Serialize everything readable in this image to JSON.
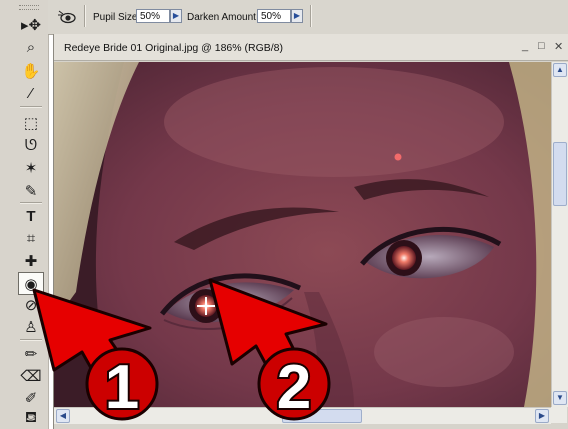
{
  "options_bar": {
    "pupil_size_label": "Pupil Size",
    "pupil_size_value": "50%",
    "darken_amount_label": "Darken Amount",
    "darken_amount_value": "50%"
  },
  "document": {
    "title": "Redeye Bride 01 Original.jpg @ 186% (RGB/8)",
    "minimize_glyph": "_",
    "maximize_glyph": "□",
    "close_glyph": "✕"
  },
  "toolbox": {
    "tools": [
      {
        "name": "move-tool",
        "glyph": "▸✥"
      },
      {
        "name": "zoom-tool",
        "glyph": "⌕"
      },
      {
        "name": "hand-tool",
        "glyph": "✋"
      },
      {
        "name": "eyedropper-tool",
        "glyph": "⁄"
      },
      {
        "name": "marquee-tool",
        "glyph": "⬚"
      },
      {
        "name": "lasso-tool",
        "glyph": "ᘎ"
      },
      {
        "name": "magic-wand-tool",
        "glyph": "✶"
      },
      {
        "name": "quick-selection-tool",
        "glyph": "✎"
      },
      {
        "name": "type-tool",
        "glyph": "T"
      },
      {
        "name": "crop-tool",
        "glyph": "⌗"
      },
      {
        "name": "spot-healing-tool",
        "glyph": "✚"
      },
      {
        "name": "red-eye-tool",
        "glyph": "◉"
      },
      {
        "name": "healing-brush-tool",
        "glyph": "⊘"
      },
      {
        "name": "clone-stamp-tool",
        "glyph": "♙"
      },
      {
        "name": "pencil-tool",
        "glyph": "✏"
      },
      {
        "name": "eraser-tool",
        "glyph": "⌫"
      },
      {
        "name": "brush-tool",
        "glyph": "✐"
      },
      {
        "name": "paint-bucket-tool",
        "glyph": "⛾"
      }
    ],
    "active_tool": "red-eye-tool"
  },
  "annotations": {
    "callout_1": "1",
    "callout_2": "2",
    "arrow_color": "#e60000",
    "badge_color": "#cc0000"
  },
  "scrollbars": {
    "up": "▲",
    "down": "▼",
    "left": "◀",
    "right": "▶"
  }
}
